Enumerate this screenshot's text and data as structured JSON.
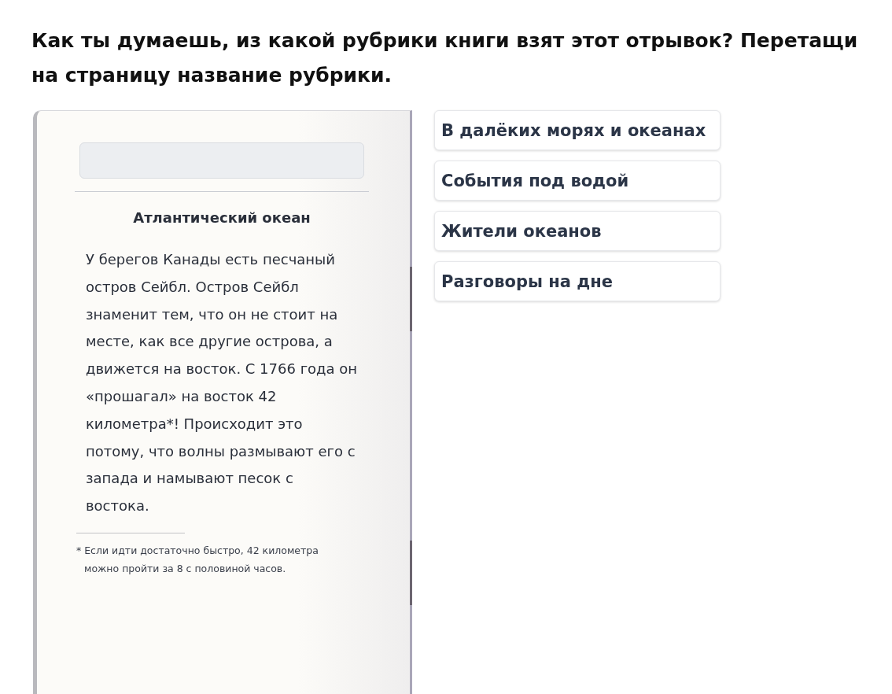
{
  "question": "Как ты думаешь, из какой рубрики книги взят этот отрывок? Перетащи на страницу название рубрики.",
  "book_page": {
    "heading": "Атлантический океан",
    "text": "У берегов Канады есть песчаный остров Сейбл. Остров Сейбл знаменит тем, что он не стоит на месте, как все другие острова, а движется на восток. С 1766 года он «прошагал» на восток 42 километра*! Происходит это потому, что волны размывают его с запада и намывают песок с востока.",
    "footnote": "* Если идти достаточно быстро, 42 километра можно пройти за 8 с половиной часов."
  },
  "options": [
    {
      "label": "В далёких морях и океанах"
    },
    {
      "label": "События под водой"
    },
    {
      "label": "Жители океанов"
    },
    {
      "label": "Разговоры на дне"
    }
  ]
}
